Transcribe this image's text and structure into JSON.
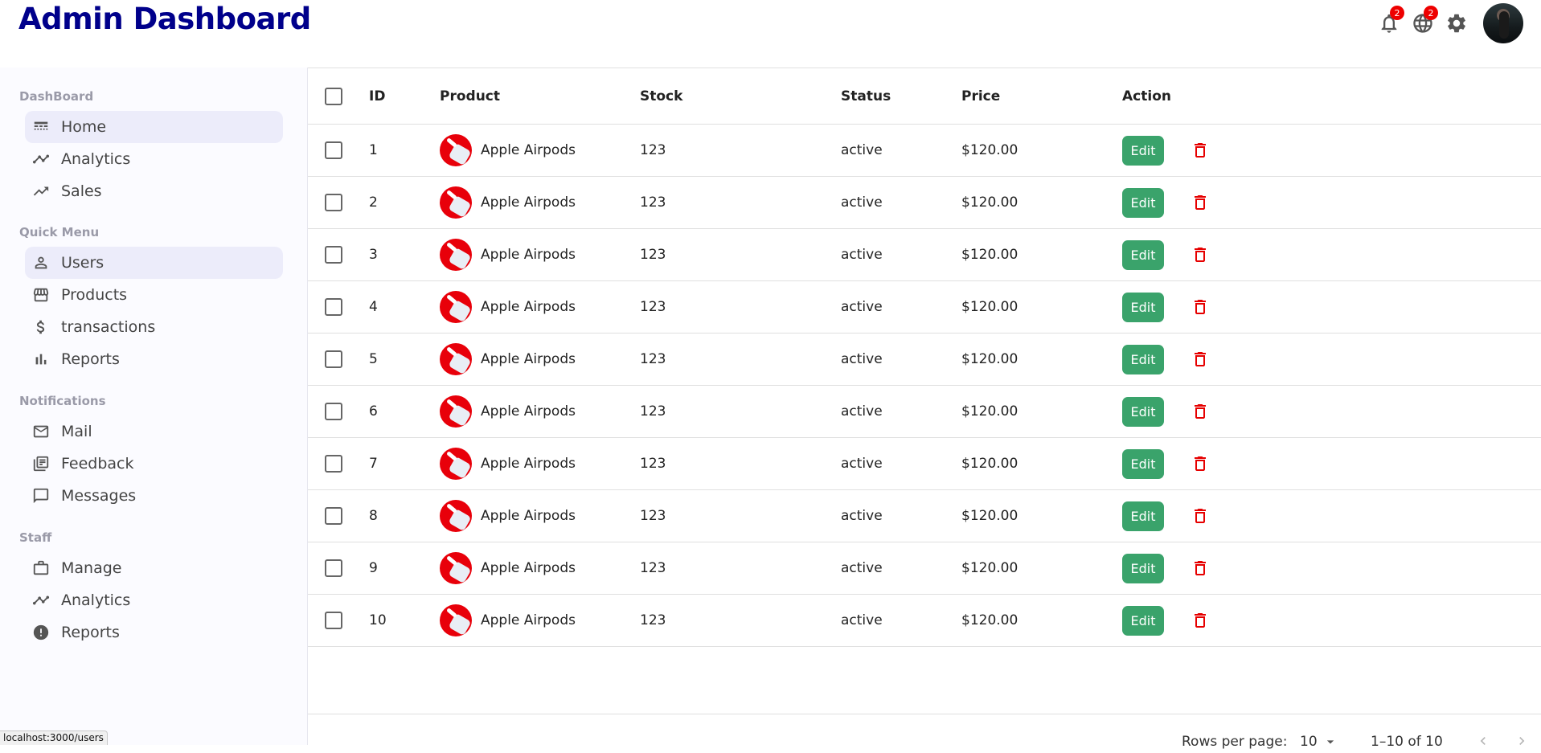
{
  "header": {
    "title": "Admin Dashboard",
    "notifications_count": "2",
    "language_count": "2",
    "icons": [
      "bell-icon",
      "globe-icon",
      "gear-icon"
    ]
  },
  "sidebar": {
    "sections": [
      {
        "title": "DashBoard",
        "items": [
          {
            "label": "Home",
            "icon": "dashboard-icon",
            "active": true
          },
          {
            "label": "Analytics",
            "icon": "timeline-icon"
          },
          {
            "label": "Sales",
            "icon": "trending-up-icon"
          }
        ]
      },
      {
        "title": "Quick Menu",
        "items": [
          {
            "label": "Users",
            "icon": "user-icon",
            "active": true
          },
          {
            "label": "Products",
            "icon": "storefront-icon"
          },
          {
            "label": "transactions",
            "icon": "dollar-icon"
          },
          {
            "label": "Reports",
            "icon": "bar-chart-icon"
          }
        ]
      },
      {
        "title": "Notifications",
        "items": [
          {
            "label": "Mail",
            "icon": "mail-icon"
          },
          {
            "label": "Feedback",
            "icon": "feedback-icon"
          },
          {
            "label": "Messages",
            "icon": "chat-icon"
          }
        ]
      },
      {
        "title": "Staff",
        "items": [
          {
            "label": "Manage",
            "icon": "briefcase-icon"
          },
          {
            "label": "Analytics",
            "icon": "timeline-icon"
          },
          {
            "label": "Reports",
            "icon": "report-icon"
          }
        ]
      }
    ]
  },
  "status_url": "localhost:3000/users",
  "table": {
    "columns": [
      "ID",
      "Product",
      "Stock",
      "Status",
      "Price",
      "Action"
    ],
    "edit_label": "Edit",
    "rows": [
      {
        "id": "1",
        "product": "Apple Airpods",
        "stock": "123",
        "status": "active",
        "price": "$120.00"
      },
      {
        "id": "2",
        "product": "Apple Airpods",
        "stock": "123",
        "status": "active",
        "price": "$120.00"
      },
      {
        "id": "3",
        "product": "Apple Airpods",
        "stock": "123",
        "status": "active",
        "price": "$120.00"
      },
      {
        "id": "4",
        "product": "Apple Airpods",
        "stock": "123",
        "status": "active",
        "price": "$120.00"
      },
      {
        "id": "5",
        "product": "Apple Airpods",
        "stock": "123",
        "status": "active",
        "price": "$120.00"
      },
      {
        "id": "6",
        "product": "Apple Airpods",
        "stock": "123",
        "status": "active",
        "price": "$120.00"
      },
      {
        "id": "7",
        "product": "Apple Airpods",
        "stock": "123",
        "status": "active",
        "price": "$120.00"
      },
      {
        "id": "8",
        "product": "Apple Airpods",
        "stock": "123",
        "status": "active",
        "price": "$120.00"
      },
      {
        "id": "9",
        "product": "Apple Airpods",
        "stock": "123",
        "status": "active",
        "price": "$120.00"
      },
      {
        "id": "10",
        "product": "Apple Airpods",
        "stock": "123",
        "status": "active",
        "price": "$120.00"
      }
    ]
  },
  "pagination": {
    "rows_per_page_label": "Rows per page:",
    "rows_per_page_value": "10",
    "range_text": "1–10 of 10"
  },
  "colors": {
    "title": "#00008b",
    "edit_button": "#3aa36b",
    "delete_icon": "#e60000",
    "badge": "#ee0000",
    "active_nav": "#ececfa"
  }
}
